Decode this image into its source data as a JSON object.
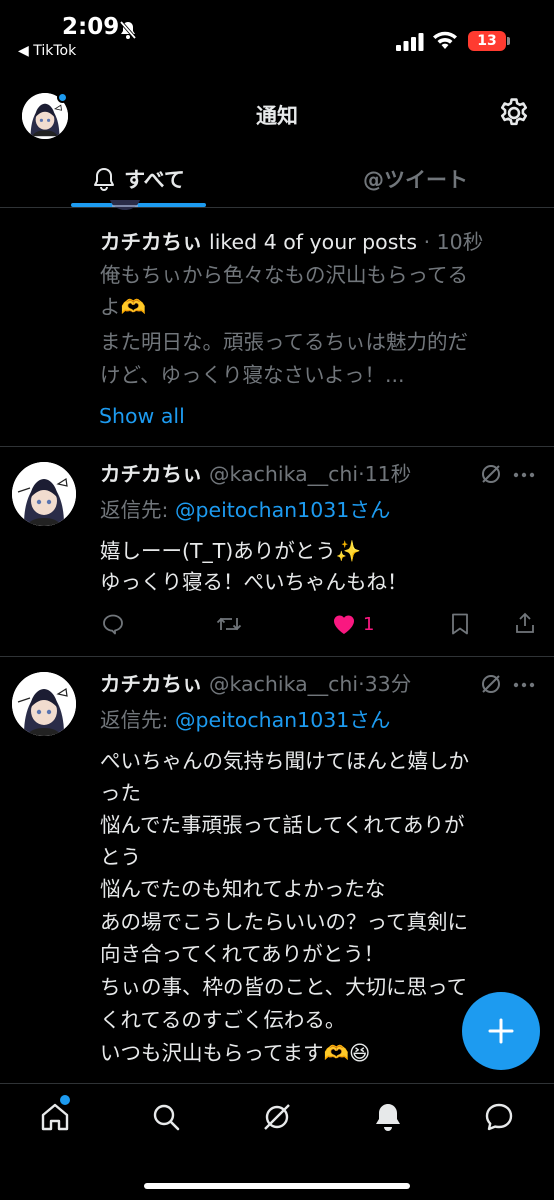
{
  "status_bar": {
    "time": "2:09",
    "back_app": "◀ TikTok",
    "battery": "13"
  },
  "header": {
    "title": "通知"
  },
  "tabs": {
    "all": "すべて",
    "mentions": "@ツイート"
  },
  "like_notification": {
    "user": "カチカちぃ",
    "action": " liked 4 of your posts",
    "time": " · 10秒",
    "lines": [
      "俺もちぃから色々なもの沢山もらってる",
      "よ🫶",
      "また明日な。頑張ってるちぃは魅力的だ",
      "けど、ゆっくり寝なさいよっ！..."
    ],
    "show_all": "Show all"
  },
  "tweets": [
    {
      "name": "カチカちぃ",
      "handle": "@kachika__chi",
      "time": "·11秒",
      "reply_label": "返信先: ",
      "reply_to": "@peitochan1031さん",
      "lines": [
        "嬉しーー(T_T)ありがとう✨",
        "ゆっくり寝る！ぺいちゃんもね！"
      ],
      "likes": "1"
    },
    {
      "name": "カチカちぃ",
      "handle": "@kachika__chi",
      "time": "·33分",
      "reply_label": "返信先: ",
      "reply_to": "@peitochan1031さん",
      "lines": [
        "ぺいちゃんの気持ち聞けてほんと嬉しか",
        "った",
        "悩んでた事頑張って話してくれてありが",
        "とう",
        "悩んでたのも知れてよかったな",
        "あの場でこうしたらいいの？って真剣に",
        "向き合ってくれてありがとう！",
        "ちぃの事、枠の皆のこと、大切に思って",
        "くれてるのすごく伝わる。",
        "いつも沢山もらってます🫶😆"
      ]
    }
  ],
  "colors": {
    "accent": "#1d9bf0",
    "like": "#f91880",
    "muted": "#71767b",
    "background": "#000000"
  },
  "icons": [
    "bell-slash-icon",
    "signal-icon",
    "wifi-icon",
    "settings-gear-icon",
    "bell-icon",
    "reply-icon",
    "retweet-icon",
    "heart-icon",
    "bookmark-icon",
    "share-icon",
    "grok-icon",
    "more-icon",
    "compose-plus-icon",
    "home-icon",
    "search-icon",
    "bell-filled-icon",
    "messages-icon"
  ]
}
